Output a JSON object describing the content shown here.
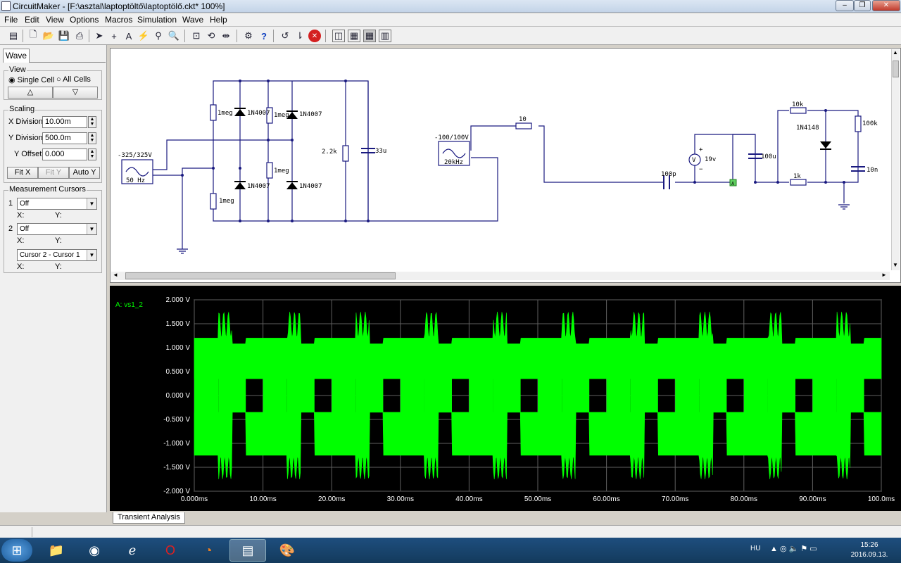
{
  "window": {
    "title": "CircuitMaker - [F:\\asztal\\laptoptöltő\\laptoptölő.ckt* 100%]"
  },
  "menu": [
    "File",
    "Edit",
    "View",
    "Options",
    "Macros",
    "Simulation",
    "Wave",
    "Help"
  ],
  "panel": {
    "tab": "Wave",
    "view": {
      "legend": "View",
      "single": "Single Cell",
      "all": "All Cells",
      "up": "△",
      "down": "▽"
    },
    "scaling": {
      "legend": "Scaling",
      "xlabel": "X Division",
      "xval": "10.00m",
      "ylabel": "Y Division",
      "yval": "500.0m",
      "olabel": "Y Offset",
      "oval": "0.000",
      "fitx": "Fit X",
      "fity": "Fit Y",
      "autoy": "Auto Y"
    },
    "cursors": {
      "legend": "Measurement Cursors",
      "c1": "1",
      "c2": "2",
      "v1": "Off",
      "v2": "Off",
      "diff": "Cursor 2 - Cursor 1",
      "x": "X:",
      "y": "Y:"
    }
  },
  "schematic": {
    "labels": {
      "src1": "-325/325V",
      "src1f": "50 Hz",
      "r1": "1meg",
      "r2": "1meg",
      "r3": "1meg",
      "r4": "1meg",
      "d1": "1N4007",
      "d2": "1N4007",
      "d3": "1N4007",
      "d4": "1N4007",
      "r22": "2.2k",
      "c33": "33u",
      "src2": "-100/100V",
      "src2f": "20kHz",
      "r10": "10",
      "c100p": "100p",
      "vm": "19v",
      "c100u": "100u",
      "r10k": "10k",
      "d5": "1N4148",
      "r100k": "100k",
      "r1k": "1k",
      "c10n": "10n",
      "probe": "A",
      "vm_sym": "V",
      "plus": "+",
      "minus": "−"
    }
  },
  "wave": {
    "trace": "A: vs1_2",
    "tab": "Transient Analysis",
    "color": "#00ff00"
  },
  "chart_data": {
    "type": "line",
    "title": "",
    "series": [
      {
        "name": "A: vs1_2",
        "description_values": {
          "envelope_high_max": 1.75,
          "envelope_low_min": -1.75,
          "plateau_high": 1.2,
          "plateau_low": -1.25,
          "gap_inner": 0.35,
          "period_ms": 10
        }
      }
    ],
    "yticks": [
      "2.000 V",
      "1.500 V",
      "1.000 V",
      "0.500 V",
      "0.000 V",
      "-0.500 V",
      "-1.000 V",
      "-1.500 V",
      "-2.000 V"
    ],
    "xticks": [
      "0.000ms",
      "10.00ms",
      "20.00ms",
      "30.00ms",
      "40.00ms",
      "50.00ms",
      "60.00ms",
      "70.00ms",
      "80.00ms",
      "90.00ms",
      "100.0ms"
    ],
    "xlim": [
      0,
      100
    ],
    "ylim": [
      -2,
      2
    ],
    "grid": true
  },
  "taskbar": {
    "lang": "HU",
    "time": "15:26",
    "date": "2016.09.13."
  }
}
